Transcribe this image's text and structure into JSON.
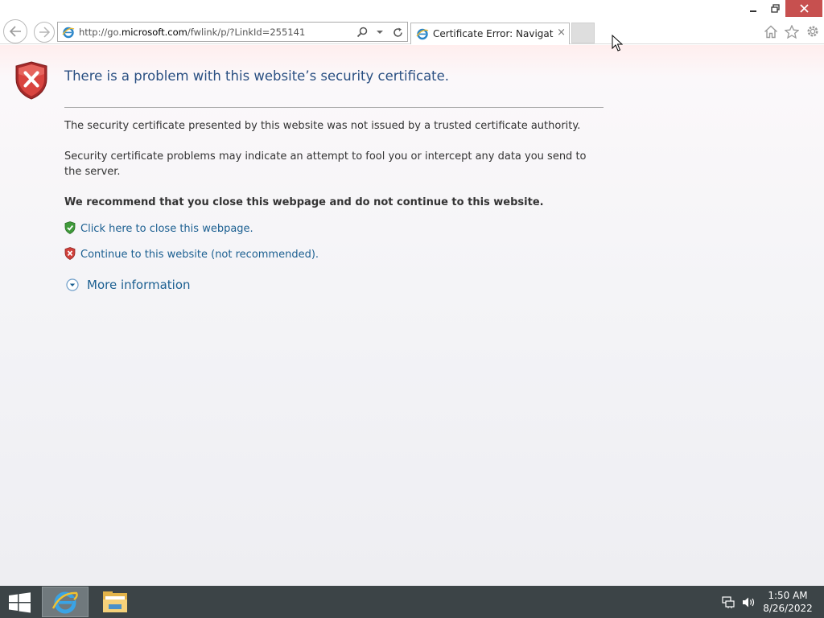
{
  "browser": {
    "address_bar": {
      "url_prefix": "http://go.",
      "url_domain": "microsoft.com",
      "url_path": "/fwlink/p/?LinkId=255141"
    },
    "tab": {
      "title": "Certificate Error: Navigation...",
      "close_glyph": "×"
    },
    "icons": [
      "back-arrow-icon",
      "forward-arrow-icon",
      "ie-favicon",
      "search-icon",
      "dropdown-icon",
      "refresh-icon",
      "home-icon",
      "star-icon",
      "gear-icon"
    ]
  },
  "page": {
    "headline": "There is a problem with this website’s security certificate.",
    "paragraph_1": "The security certificate presented by this website was not issued by a trusted certificate authority.",
    "paragraph_2": "Security certificate problems may indicate an attempt to fool you or intercept any data you send to the server.",
    "recommendation": "We recommend that you close this webpage and do not continue to this website.",
    "close_link": "Click here to close this webpage.",
    "continue_link": "Continue to this website (not recommended).",
    "more_information": "More information"
  },
  "taskbar": {
    "clock": {
      "time": "1:50 AM",
      "date": "8/26/2022"
    },
    "pinned": [
      "internet-explorer",
      "file-explorer"
    ]
  },
  "colors": {
    "headline": "#2a4f82",
    "link": "#1b5f91",
    "error_red": "#c7504f",
    "shield_green": "#3f9a3a",
    "taskbar": "#3c4447"
  }
}
